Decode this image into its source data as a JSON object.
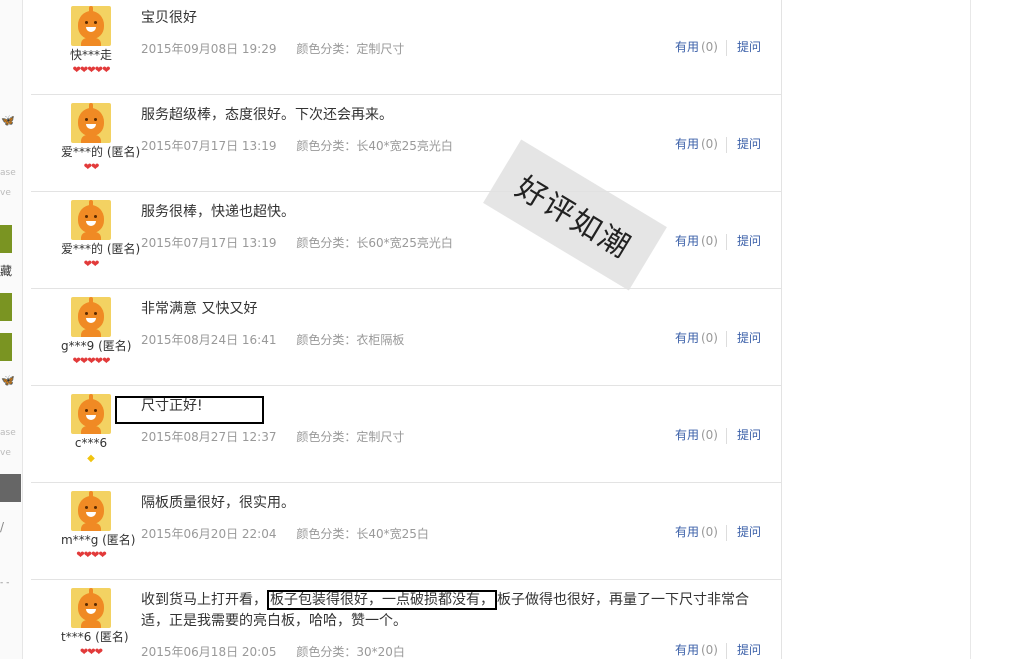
{
  "sidebar_fragments": {
    "top_text": [
      "ase",
      "ve"
    ],
    "char": "藏",
    "mid_text": [
      "ase",
      "ve"
    ],
    "slash": "/",
    "dashes": "- -"
  },
  "stamp": {
    "text": "好评如潮"
  },
  "reviews": [
    {
      "user": "快***走",
      "rank": "❤❤❤❤❤",
      "rank_type": "heart",
      "content": "宝贝很好",
      "date": "2015年09月08日 19:29",
      "spec": "颜色分类：定制尺寸",
      "useful_label": "有用",
      "useful_count": "(0)",
      "ask_label": "提问"
    },
    {
      "user": "爱***的 (匿名)",
      "rank": "❤❤",
      "rank_type": "heart",
      "content": "服务超级棒，态度很好。下次还会再来。",
      "date": "2015年07月17日 13:19",
      "spec": "颜色分类：长40*宽25亮光白",
      "useful_label": "有用",
      "useful_count": "(0)",
      "ask_label": "提问"
    },
    {
      "user": "爱***的 (匿名)",
      "rank": "❤❤",
      "rank_type": "heart",
      "content": "服务很棒，快递也超快。",
      "date": "2015年07月17日 13:19",
      "spec": "颜色分类：长60*宽25亮光白",
      "useful_label": "有用",
      "useful_count": "(0)",
      "ask_label": "提问"
    },
    {
      "user": "g***9 (匿名)",
      "rank": "❤❤❤❤❤",
      "rank_type": "heart",
      "content": "非常满意 又快又好",
      "date": "2015年08月24日 16:41",
      "spec": "颜色分类：衣柜隔板",
      "useful_label": "有用",
      "useful_count": "(0)",
      "ask_label": "提问"
    },
    {
      "user": "c***6",
      "rank": "◆",
      "rank_type": "diamond",
      "content": "尺寸正好!",
      "date": "2015年08月27日 12:37",
      "spec": "颜色分类：定制尺寸",
      "useful_label": "有用",
      "useful_count": "(0)",
      "ask_label": "提问"
    },
    {
      "user": "m***g (匿名)",
      "rank": "❤❤❤❤",
      "rank_type": "heart",
      "content": "隔板质量很好，很实用。",
      "date": "2015年06月20日 22:04",
      "spec": "颜色分类：长40*宽25白",
      "useful_label": "有用",
      "useful_count": "(0)",
      "ask_label": "提问"
    },
    {
      "user": "t***6 (匿名)",
      "rank": "❤❤❤",
      "rank_type": "heart",
      "content_pre": "收到货马上打开看，",
      "content_hl": "板子包装得很好，一点破损都没有，",
      "content_post": "板子做得也很好，再量了一下尺寸非常合适，正是我需要的亮白板，哈哈，赞一个。",
      "date": "2015年06月18日 20:05",
      "spec": "颜色分类：30*20白",
      "useful_label": "有用",
      "useful_count": "(0)",
      "ask_label": "提问"
    }
  ]
}
